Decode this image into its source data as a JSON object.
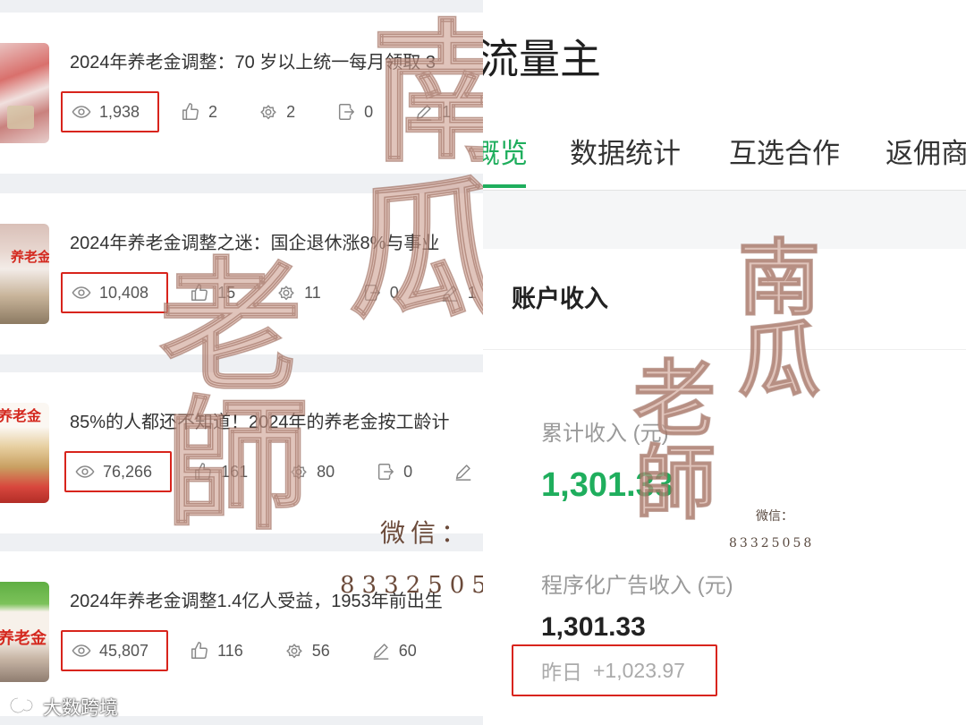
{
  "left_panel": {
    "articles": [
      {
        "title": "2024年养老金调整：70 岁以上统一每月领取 3",
        "views": "1,938",
        "stats": [
          {
            "icon": "thumb-up-icon",
            "value": "2"
          },
          {
            "icon": "gear-icon",
            "value": "2"
          },
          {
            "icon": "share-icon",
            "value": "0"
          },
          {
            "icon": "pencil-icon",
            "value": "1"
          }
        ]
      },
      {
        "thumbnail_label": "养老金",
        "title": "2024年养老金调整之迷：国企退休涨8%与事业",
        "views": "10,408",
        "stats": [
          {
            "icon": "thumb-up-icon",
            "value": "15"
          },
          {
            "icon": "gear-icon",
            "value": "11"
          },
          {
            "icon": "share-icon",
            "value": "0"
          },
          {
            "icon": "pencil-icon",
            "value": "1"
          }
        ]
      },
      {
        "thumbnail_label": "养老金",
        "title": "85%的人都还不知道！2024年的养老金按工龄计",
        "views": "76,266",
        "stats": [
          {
            "icon": "thumb-up-icon",
            "value": "161"
          },
          {
            "icon": "gear-icon",
            "value": "80"
          },
          {
            "icon": "share-icon",
            "value": "0"
          },
          {
            "icon": "pencil-icon"
          }
        ]
      },
      {
        "thumbnail_label": "养老金",
        "title": "2024年养老金调整1.4亿人受益，1953年前出生",
        "views": "45,807",
        "stats": [
          {
            "icon": "thumb-up-icon",
            "value": "116"
          },
          {
            "icon": "gear-icon",
            "value": "56"
          },
          {
            "icon": "pencil-icon",
            "value": "60"
          }
        ]
      }
    ]
  },
  "right_panel": {
    "title": "流量主",
    "tabs": [
      {
        "label": "概览",
        "active": true
      },
      {
        "label": "数据统计",
        "active": false
      },
      {
        "label": "互选合作",
        "active": false
      },
      {
        "label": "返佣商",
        "active": false
      }
    ],
    "account_income": {
      "heading": "账户收入",
      "total_label": "累计收入 (元)",
      "total_value": "1,301.33",
      "programmatic_label": "程序化广告收入 (元)",
      "programmatic_value": "1,301.33",
      "yesterday_label": "昨日",
      "yesterday_value": "+1,023.97"
    }
  },
  "watermark": {
    "characters": [
      "南",
      "瓜",
      "老",
      "師"
    ],
    "wechat_label": "微信：",
    "wechat_id_left": "8332505",
    "wechat_id_right": "83325058"
  },
  "logo": {
    "text": "大数跨境",
    "icon": "swirl-logo-icon"
  },
  "colors": {
    "accent_green": "#1fae5d",
    "highlight_red": "#d8241c",
    "watermark": "#c9a293",
    "icon_gray": "#888888"
  }
}
